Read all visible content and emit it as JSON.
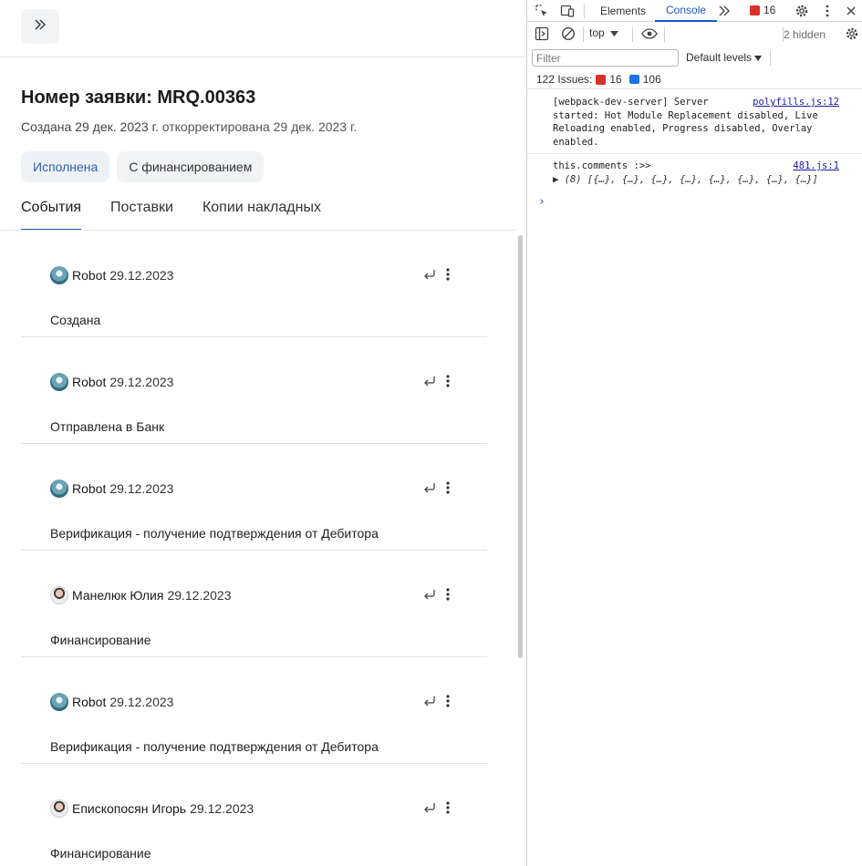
{
  "app": {
    "title": "Номер заявки: MRQ.00363",
    "subtitle_created": "Создана 29 дек. 2023 г.",
    "subtitle_updated": "откорректирована 29 дек. 2023 г.",
    "chips": [
      "Исполнена",
      "С финансированием"
    ],
    "tabs": [
      "События",
      "Поставки",
      "Копии накладных"
    ],
    "events": [
      {
        "author": "Robot",
        "date": "29.12.2023",
        "text": "Создана",
        "avatar": "robot"
      },
      {
        "author": "Robot",
        "date": "29.12.2023",
        "text": "Отправлена в Банк",
        "avatar": "robot"
      },
      {
        "author": "Robot",
        "date": "29.12.2023",
        "text": "Верификация - получение подтверждения от Дебитора",
        "avatar": "robot"
      },
      {
        "author": "Манелюк Юлия",
        "date": "29.12.2023",
        "text": "Финансирование",
        "avatar": "person"
      },
      {
        "author": "Robot",
        "date": "29.12.2023",
        "text": "Верификация - получение подтверждения от Дебитора",
        "avatar": "robot"
      },
      {
        "author": "Епископосян Игорь",
        "date": "29.12.2023",
        "text": "Финансирование",
        "avatar": "person"
      }
    ]
  },
  "devtools": {
    "tabs": [
      "Elements",
      "Console"
    ],
    "error_count": "16",
    "context": "top",
    "hidden": "2 hidden",
    "filter_placeholder": "Filter",
    "levels": "Default levels",
    "issues_label": "122 Issues:",
    "issues_errors": "16",
    "issues_info": "106",
    "logs": [
      {
        "message": "[webpack-dev-server] Server\nstarted: Hot Module Replacement disabled, Live\nReloading enabled, Progress disabled, Overlay\nenabled.",
        "source": "polyfills.js:12"
      },
      {
        "message": "this.comments :>>",
        "source": "481.js:1",
        "object": "▶ (8) [{…}, {…}, {…}, {…}, {…}, {…}, {…}, {…}]"
      }
    ],
    "prompt": "›"
  }
}
